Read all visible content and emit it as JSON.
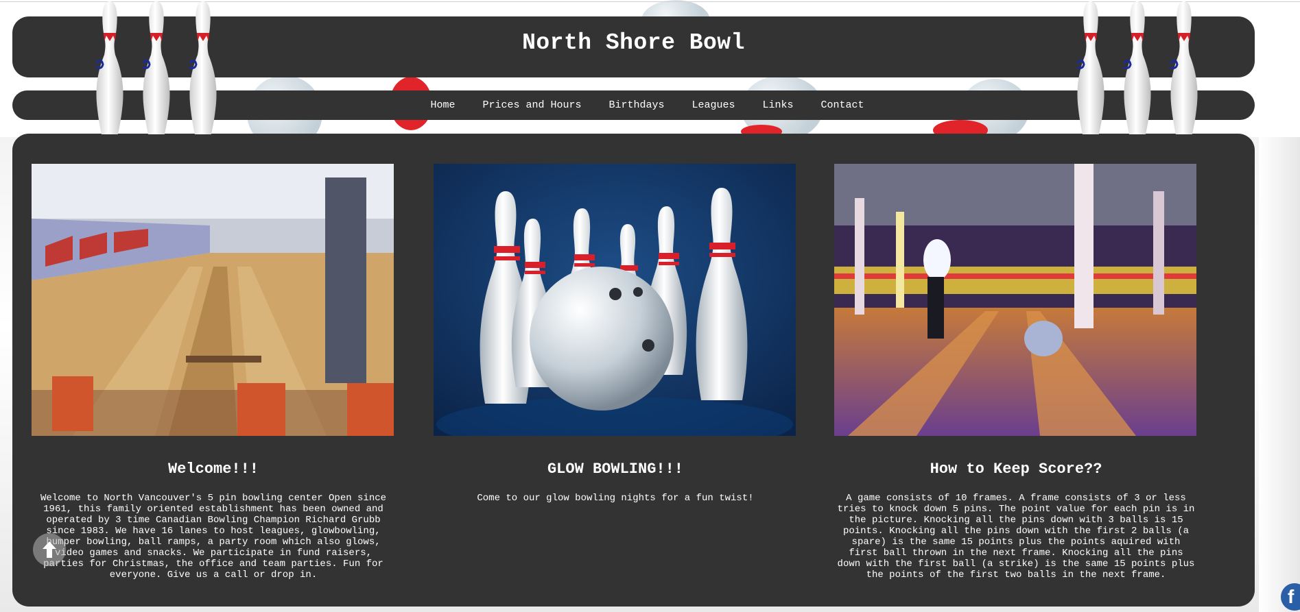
{
  "header": {
    "title": "North Shore Bowl"
  },
  "nav": {
    "items": [
      {
        "label": "Home"
      },
      {
        "label": "Prices and Hours"
      },
      {
        "label": "Birthdays"
      },
      {
        "label": "Leagues"
      },
      {
        "label": "Links"
      },
      {
        "label": "Contact"
      }
    ]
  },
  "cards": [
    {
      "title": "Welcome!!!",
      "text": "Welcome to North Vancouver's 5 pin bowling center Open since 1961, this family oriented establishment has been owned and operated by 3 time Canadian Bowling Champion Richard Grubb since 1983. We have 16 lanes to host leagues, glowbowling, bumper bowling, ball ramps, a party room which also glows, video games and snacks. We participate in fund raisers, parties for Christmas, the office and team parties. Fun for everyone. Give us a call or drop in.",
      "image": "bowling-alley-lanes-photo"
    },
    {
      "title": "GLOW BOWLING!!!",
      "text": "Come to our glow bowling nights for a fun twist!",
      "image": "bowling-pins-and-ball-photo"
    },
    {
      "title": "How to Keep Score??",
      "text": "A game consists of 10 frames. A frame consists of 3 or less tries to knock down 5 pins. The point value for each pin is in the picture. Knocking all the pins down with 3 balls is 15 points. Knocking all the pins down with the first 2 balls (a spare) is the same 15 points plus the points aquired with first ball thrown in the next frame. Knocking all the pins down with the first ball (a strike) is the same 15 points plus the points of the first two balls in the next frame.",
      "image": "glow-bowling-bowler-photo"
    }
  ],
  "widgets": {
    "scroll_top_icon": "arrow-up-icon",
    "facebook_icon": "facebook-icon",
    "facebook_letter": "f"
  },
  "colors": {
    "panel": "#333333",
    "text": "#ffffff",
    "pin_red": "#d42028",
    "facebook_blue": "#2a5fa8"
  }
}
